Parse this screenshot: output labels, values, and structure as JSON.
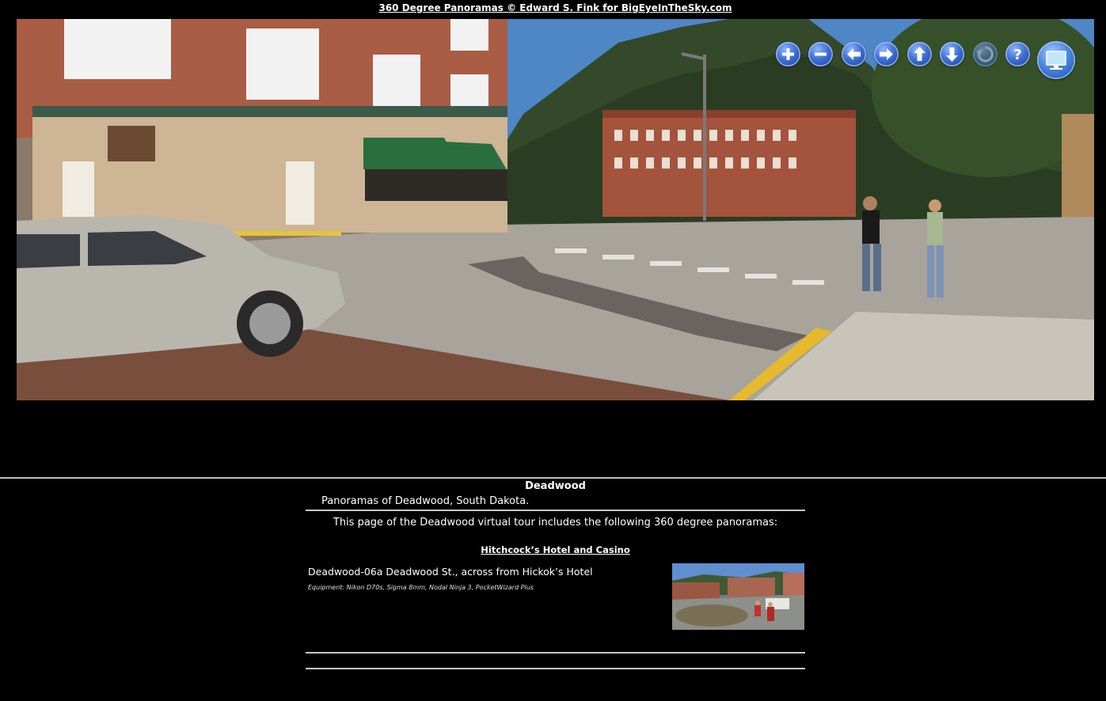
{
  "header": {
    "site_link": "360 Degree Panoramas © Edward S. Fink for BigEyeInTheSky.com"
  },
  "viewer": {
    "controls": [
      {
        "name": "zoom-in-button",
        "icon": "plus-icon"
      },
      {
        "name": "zoom-out-button",
        "icon": "minus-icon"
      },
      {
        "name": "pan-left-button",
        "icon": "arrow-left-icon"
      },
      {
        "name": "pan-right-button",
        "icon": "arrow-right-icon"
      },
      {
        "name": "pan-up-button",
        "icon": "arrow-up-icon"
      },
      {
        "name": "pan-down-button",
        "icon": "arrow-down-icon"
      },
      {
        "name": "auto-rotate-button",
        "icon": "rotate-icon"
      },
      {
        "name": "help-button",
        "icon": "question-icon"
      },
      {
        "name": "fullscreen-button",
        "icon": "monitor-icon"
      }
    ],
    "colors": {
      "button": "#3f6fd6",
      "button_rim": "#bed2ff"
    }
  },
  "page": {
    "title": "Deadwood",
    "subtitle": "Panoramas of Deadwood, South Dakota.",
    "intro": "This page of the Deadwood virtual tour includes the following 360 degree panoramas:",
    "sections": [
      {
        "link": "Hitchcock’s Hotel and Casino",
        "entries": [
          {
            "title": "Deadwood-06a Deadwood St., across from Hickok’s Hotel",
            "equipment": "Equipment: Nikon D70s, Sigma 8mm, Nodal Ninja 3, PocketWizard Plus"
          }
        ]
      }
    ]
  }
}
